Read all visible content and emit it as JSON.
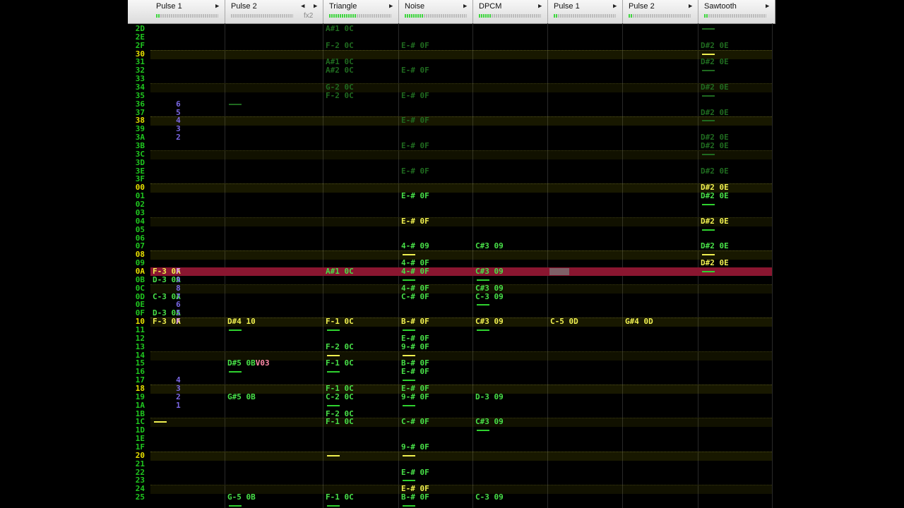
{
  "channels": [
    {
      "name": "Pulse 1",
      "fx": "",
      "level": 2
    },
    {
      "name": "Pulse 2",
      "fx": "fx2",
      "level": 0
    },
    {
      "name": "Triangle",
      "fx": "",
      "level": 13
    },
    {
      "name": "Noise",
      "fx": "",
      "level": 9
    },
    {
      "name": "DPCM",
      "fx": "",
      "level": 6
    },
    {
      "name": "Pulse 1",
      "fx": "",
      "level": 2
    },
    {
      "name": "Pulse 2",
      "fx": "",
      "level": 2
    },
    {
      "name": "Sawtooth",
      "fx": "",
      "level": 2
    }
  ],
  "colors": {
    "cursor_row": "#8a1630",
    "note": "#48e048",
    "highlight": "#f0f050",
    "volume": "#7b68e6"
  },
  "rows": [
    "2D",
    "2E",
    "2F",
    "30",
    "31",
    "32",
    "33",
    "34",
    "35",
    "36",
    "37",
    "38",
    "39",
    "3A",
    "3B",
    "3C",
    "3D",
    "3E",
    "3F",
    "00",
    "01",
    "02",
    "03",
    "04",
    "05",
    "06",
    "07",
    "08",
    "09",
    "0A",
    "0B",
    "0C",
    "0D",
    "0E",
    "0F",
    "10",
    "11",
    "12",
    "13",
    "14",
    "15",
    "16",
    "17",
    "18",
    "19",
    "1A",
    "1B",
    "1C",
    "1D",
    "1E",
    "1F",
    "20",
    "21",
    "22",
    "23",
    "24",
    "25"
  ],
  "cursor_row": 29,
  "cells": [
    {
      "ch": 2,
      "row": 0,
      "text": "A#1 0C",
      "c": "nbd"
    },
    {
      "ch": 2,
      "row": 2,
      "text": "F-2 0C",
      "c": "nbd"
    },
    {
      "ch": 3,
      "row": 2,
      "text": "E-# 0F",
      "c": "nbd"
    },
    {
      "ch": 7,
      "row": 2,
      "text": "D#2 0E",
      "c": "nbd"
    },
    {
      "ch": 2,
      "row": 4,
      "text": "A#1 0C",
      "c": "nbd"
    },
    {
      "ch": 7,
      "row": 4,
      "text": "D#2 0E",
      "c": "nbd"
    },
    {
      "ch": 2,
      "row": 5,
      "text": "A#2 0C",
      "c": "nbd"
    },
    {
      "ch": 3,
      "row": 5,
      "text": "E-# 0F",
      "c": "nbd"
    },
    {
      "ch": 2,
      "row": 7,
      "text": "G-2 0C",
      "c": "nbd"
    },
    {
      "ch": 7,
      "row": 7,
      "text": "D#2 0E",
      "c": "nbd"
    },
    {
      "ch": 2,
      "row": 8,
      "text": "F-2 0C",
      "c": "nbd"
    },
    {
      "ch": 3,
      "row": 8,
      "text": "E-# 0F",
      "c": "nbd"
    },
    {
      "ch": 0,
      "row": 9,
      "text": "     6",
      "c": "vol"
    },
    {
      "ch": 0,
      "row": 10,
      "text": "     5",
      "c": "vol"
    },
    {
      "ch": 7,
      "row": 10,
      "text": "D#2 0E",
      "c": "nbd"
    },
    {
      "ch": 0,
      "row": 11,
      "text": "     4",
      "c": "vol"
    },
    {
      "ch": 3,
      "row": 11,
      "text": "E-# 0F",
      "c": "nbd"
    },
    {
      "ch": 0,
      "row": 12,
      "text": "     3",
      "c": "vol"
    },
    {
      "ch": 0,
      "row": 13,
      "text": "     2",
      "c": "vol"
    },
    {
      "ch": 7,
      "row": 13,
      "text": "D#2 0E",
      "c": "nbd"
    },
    {
      "ch": 3,
      "row": 14,
      "text": "E-# 0F",
      "c": "nbd"
    },
    {
      "ch": 7,
      "row": 14,
      "text": "D#2 0E",
      "c": "nbd"
    },
    {
      "ch": 3,
      "row": 17,
      "text": "E-# 0F",
      "c": "nbd"
    },
    {
      "ch": 7,
      "row": 17,
      "text": "D#2 0E",
      "c": "nbd"
    },
    {
      "ch": 7,
      "row": 19,
      "text": "D#2 0E",
      "c": "ny"
    },
    {
      "ch": 3,
      "row": 20,
      "text": "E-# 0F",
      "c": "nb"
    },
    {
      "ch": 7,
      "row": 20,
      "text": "D#2 0E",
      "c": "nb"
    },
    {
      "ch": 3,
      "row": 23,
      "text": "E-# 0F",
      "c": "ny"
    },
    {
      "ch": 7,
      "row": 23,
      "text": "D#2 0E",
      "c": "ny"
    },
    {
      "ch": 3,
      "row": 26,
      "text": "4-# 09",
      "c": "nb"
    },
    {
      "ch": 4,
      "row": 26,
      "text": "C#3 09",
      "c": "nb"
    },
    {
      "ch": 7,
      "row": 26,
      "text": "D#2 0E",
      "c": "nb"
    },
    {
      "ch": 3,
      "row": 28,
      "text": "4-# 0F",
      "c": "nb"
    },
    {
      "ch": 7,
      "row": 28,
      "text": "D#2 0E",
      "c": "ny"
    },
    {
      "ch": 0,
      "row": 29,
      "text": "F-3 0A",
      "c": "ny"
    },
    {
      "ch": 0,
      "row": 29,
      "text": "     F",
      "c": "volp"
    },
    {
      "ch": 2,
      "row": 29,
      "text": "A#1 0C",
      "c": "nb"
    },
    {
      "ch": 3,
      "row": 29,
      "text": "4-# 0F",
      "c": "nb"
    },
    {
      "ch": 4,
      "row": 29,
      "text": "C#3 09",
      "c": "nb"
    },
    {
      "ch": 0,
      "row": 30,
      "text": "D-3 0A",
      "c": "nb"
    },
    {
      "ch": 0,
      "row": 30,
      "text": "     9",
      "c": "vol"
    },
    {
      "ch": 0,
      "row": 31,
      "text": "     8",
      "c": "vol"
    },
    {
      "ch": 3,
      "row": 31,
      "text": "4-# 0F",
      "c": "nb"
    },
    {
      "ch": 4,
      "row": 31,
      "text": "C#3 09",
      "c": "nb"
    },
    {
      "ch": 0,
      "row": 32,
      "text": "C-3 0A",
      "c": "nb"
    },
    {
      "ch": 0,
      "row": 32,
      "text": "     7",
      "c": "vol"
    },
    {
      "ch": 3,
      "row": 32,
      "text": "C-# 0F",
      "c": "nb"
    },
    {
      "ch": 4,
      "row": 32,
      "text": "C-3 09",
      "c": "nb"
    },
    {
      "ch": 0,
      "row": 33,
      "text": "     6",
      "c": "vol"
    },
    {
      "ch": 0,
      "row": 34,
      "text": "D-3 0A",
      "c": "nb"
    },
    {
      "ch": 0,
      "row": 34,
      "text": "     5",
      "c": "vol"
    },
    {
      "ch": 0,
      "row": 35,
      "text": "F-3 0A",
      "c": "ny"
    },
    {
      "ch": 0,
      "row": 35,
      "text": "     F",
      "c": "volp"
    },
    {
      "ch": 1,
      "row": 35,
      "text": "D#4 10",
      "c": "ny"
    },
    {
      "ch": 2,
      "row": 35,
      "text": "F-1 0C",
      "c": "ny"
    },
    {
      "ch": 3,
      "row": 35,
      "text": "B-# 0F",
      "c": "ny"
    },
    {
      "ch": 4,
      "row": 35,
      "text": "C#3 09",
      "c": "ny"
    },
    {
      "ch": 5,
      "row": 35,
      "text": "C-5 0D",
      "c": "ny"
    },
    {
      "ch": 6,
      "row": 35,
      "text": "G#4 0D",
      "c": "ny"
    },
    {
      "ch": 3,
      "row": 37,
      "text": "E-# 0F",
      "c": "nb"
    },
    {
      "ch": 2,
      "row": 38,
      "text": "F-2 0C",
      "c": "nb"
    },
    {
      "ch": 3,
      "row": 38,
      "text": "9-# 0F",
      "c": "nb"
    },
    {
      "ch": 1,
      "row": 40,
      "text": "D#5 0B",
      "c": "nb"
    },
    {
      "ch": 1,
      "row": 40,
      "text": "      V03",
      "c": "eff"
    },
    {
      "ch": 2,
      "row": 40,
      "text": "F-1 0C",
      "c": "nb"
    },
    {
      "ch": 3,
      "row": 40,
      "text": "B-# 0F",
      "c": "nb"
    },
    {
      "ch": 3,
      "row": 41,
      "text": "E-# 0F",
      "c": "nb"
    },
    {
      "ch": 0,
      "row": 42,
      "text": "     4",
      "c": "vol"
    },
    {
      "ch": 0,
      "row": 43,
      "text": "     3",
      "c": "vol"
    },
    {
      "ch": 2,
      "row": 43,
      "text": "F-1 0C",
      "c": "nb"
    },
    {
      "ch": 3,
      "row": 43,
      "text": "E-# 0F",
      "c": "nb"
    },
    {
      "ch": 0,
      "row": 44,
      "text": "     2",
      "c": "vol"
    },
    {
      "ch": 1,
      "row": 44,
      "text": "G#5 0B",
      "c": "nb"
    },
    {
      "ch": 2,
      "row": 44,
      "text": "C-2 0C",
      "c": "nb"
    },
    {
      "ch": 3,
      "row": 44,
      "text": "9-# 0F",
      "c": "nb"
    },
    {
      "ch": 4,
      "row": 44,
      "text": "D-3 09",
      "c": "nb"
    },
    {
      "ch": 0,
      "row": 45,
      "text": "     1",
      "c": "vol"
    },
    {
      "ch": 2,
      "row": 46,
      "text": "F-2 0C",
      "c": "nb"
    },
    {
      "ch": 2,
      "row": 47,
      "text": "F-1 0C",
      "c": "nb"
    },
    {
      "ch": 3,
      "row": 47,
      "text": "C-# 0F",
      "c": "nb"
    },
    {
      "ch": 4,
      "row": 47,
      "text": "C#3 09",
      "c": "nb"
    },
    {
      "ch": 3,
      "row": 50,
      "text": "9-# 0F",
      "c": "nb"
    },
    {
      "ch": 3,
      "row": 53,
      "text": "E-# 0F",
      "c": "nb"
    },
    {
      "ch": 3,
      "row": 55,
      "text": "E-# 0F",
      "c": "ny"
    },
    {
      "ch": 1,
      "row": 56,
      "text": "G-5 0B",
      "c": "nb"
    },
    {
      "ch": 2,
      "row": 56,
      "text": "F-1 0C",
      "c": "nb"
    },
    {
      "ch": 3,
      "row": 56,
      "text": "B-# 0F",
      "c": "nb"
    },
    {
      "ch": 4,
      "row": 56,
      "text": "C-3 09",
      "c": "nb"
    }
  ],
  "dashes": [
    {
      "ch": 1,
      "row": 9,
      "c": "d"
    },
    {
      "ch": 7,
      "row": 0,
      "c": "d"
    },
    {
      "ch": 7,
      "row": 3,
      "c": "y"
    },
    {
      "ch": 7,
      "row": 5,
      "c": "d"
    },
    {
      "ch": 7,
      "row": 8,
      "c": "d"
    },
    {
      "ch": 7,
      "row": 11,
      "c": "d"
    },
    {
      "ch": 7,
      "row": 15,
      "c": "d"
    },
    {
      "ch": 7,
      "row": 21,
      "c": "g"
    },
    {
      "ch": 7,
      "row": 24,
      "c": "g"
    },
    {
      "ch": 3,
      "row": 27,
      "c": "y"
    },
    {
      "ch": 7,
      "row": 27,
      "c": "y"
    },
    {
      "ch": 7,
      "row": 29,
      "c": "g"
    },
    {
      "ch": 3,
      "row": 30,
      "c": "g"
    },
    {
      "ch": 4,
      "row": 30,
      "c": "g"
    },
    {
      "ch": 4,
      "row": 33,
      "c": "g"
    },
    {
      "ch": 1,
      "row": 36,
      "c": "g"
    },
    {
      "ch": 2,
      "row": 36,
      "c": "g"
    },
    {
      "ch": 3,
      "row": 36,
      "c": "g"
    },
    {
      "ch": 4,
      "row": 36,
      "c": "g"
    },
    {
      "ch": 2,
      "row": 39,
      "c": "y"
    },
    {
      "ch": 3,
      "row": 39,
      "c": "y"
    },
    {
      "ch": 1,
      "row": 41,
      "c": "g"
    },
    {
      "ch": 2,
      "row": 41,
      "c": "g"
    },
    {
      "ch": 3,
      "row": 42,
      "c": "g"
    },
    {
      "ch": 2,
      "row": 45,
      "c": "g"
    },
    {
      "ch": 3,
      "row": 45,
      "c": "g"
    },
    {
      "ch": 0,
      "row": 47,
      "c": "y"
    },
    {
      "ch": 4,
      "row": 48,
      "c": "g"
    },
    {
      "ch": 2,
      "row": 51,
      "c": "y"
    },
    {
      "ch": 3,
      "row": 51,
      "c": "y"
    },
    {
      "ch": 3,
      "row": 54,
      "c": "g"
    },
    {
      "ch": 1,
      "row": 57,
      "c": "g"
    },
    {
      "ch": 2,
      "row": 57,
      "c": "g"
    },
    {
      "ch": 3,
      "row": 57,
      "c": "g"
    }
  ]
}
